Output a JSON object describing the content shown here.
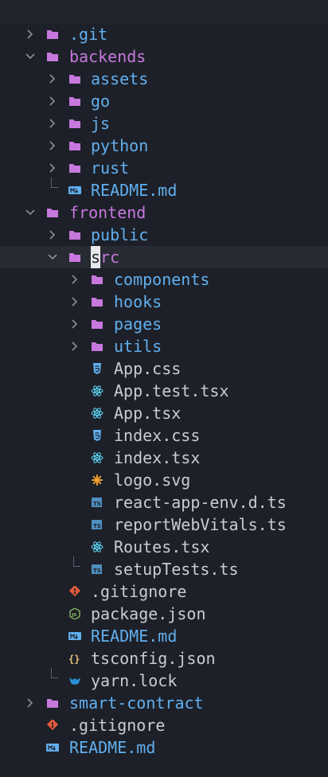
{
  "colors": {
    "background": "#1d2028",
    "folder_purple": "#c678dd",
    "folder_icon": "#c678dd",
    "accent_blue": "#61afef",
    "git_red": "#e05a3a",
    "svg_orange": "#f0a030",
    "json_yellow": "#e5c07b",
    "node_green": "#8cc265",
    "yarn_blue": "#2a8fd6",
    "react_cyan": "#61dafb"
  },
  "tree": {
    "git": {
      "label": ".git",
      "icon": "folder-icon"
    },
    "backends": {
      "label": "backends",
      "icon": "folder-icon"
    },
    "backends_assets": {
      "label": "assets",
      "icon": "folder-icon"
    },
    "backends_go": {
      "label": "go",
      "icon": "folder-icon"
    },
    "backends_js": {
      "label": "js",
      "icon": "folder-icon"
    },
    "backends_python": {
      "label": "python",
      "icon": "folder-icon"
    },
    "backends_rust": {
      "label": "rust",
      "icon": "folder-icon"
    },
    "backends_readme": {
      "label": "README.md",
      "icon": "markdown-icon"
    },
    "frontend": {
      "label": "frontend",
      "icon": "folder-icon"
    },
    "frontend_public": {
      "label": "public",
      "icon": "folder-icon"
    },
    "frontend_src": {
      "label": "src",
      "icon": "folder-icon"
    },
    "src_components": {
      "label": "components",
      "icon": "folder-icon"
    },
    "src_hooks": {
      "label": "hooks",
      "icon": "folder-icon"
    },
    "src_pages": {
      "label": "pages",
      "icon": "folder-icon"
    },
    "src_utils": {
      "label": "utils",
      "icon": "folder-icon"
    },
    "src_app_css": {
      "label": "App.css",
      "icon": "css-icon"
    },
    "src_app_test": {
      "label": "App.test.tsx",
      "icon": "react-icon"
    },
    "src_app_tsx": {
      "label": "App.tsx",
      "icon": "react-icon"
    },
    "src_index_css": {
      "label": "index.css",
      "icon": "css-icon"
    },
    "src_index_tsx": {
      "label": "index.tsx",
      "icon": "react-icon"
    },
    "src_logo_svg": {
      "label": "logo.svg",
      "icon": "svg-icon"
    },
    "src_react_env": {
      "label": "react-app-env.d.ts",
      "icon": "typescript-icon"
    },
    "src_report": {
      "label": "reportWebVitals.ts",
      "icon": "typescript-icon"
    },
    "src_routes": {
      "label": "Routes.tsx",
      "icon": "react-icon"
    },
    "src_setup": {
      "label": "setupTests.ts",
      "icon": "typescript-icon"
    },
    "frontend_gitignore": {
      "label": ".gitignore",
      "icon": "git-icon"
    },
    "frontend_package": {
      "label": "package.json",
      "icon": "node-icon"
    },
    "frontend_readme": {
      "label": "README.md",
      "icon": "markdown-icon"
    },
    "frontend_tsconfig": {
      "label": "tsconfig.json",
      "icon": "json-icon"
    },
    "frontend_yarn": {
      "label": "yarn.lock",
      "icon": "yarn-icon"
    },
    "smart_contract": {
      "label": "smart-contract",
      "icon": "folder-icon"
    },
    "root_gitignore": {
      "label": ".gitignore",
      "icon": "git-icon"
    },
    "root_readme": {
      "label": "README.md",
      "icon": "markdown-icon"
    }
  }
}
